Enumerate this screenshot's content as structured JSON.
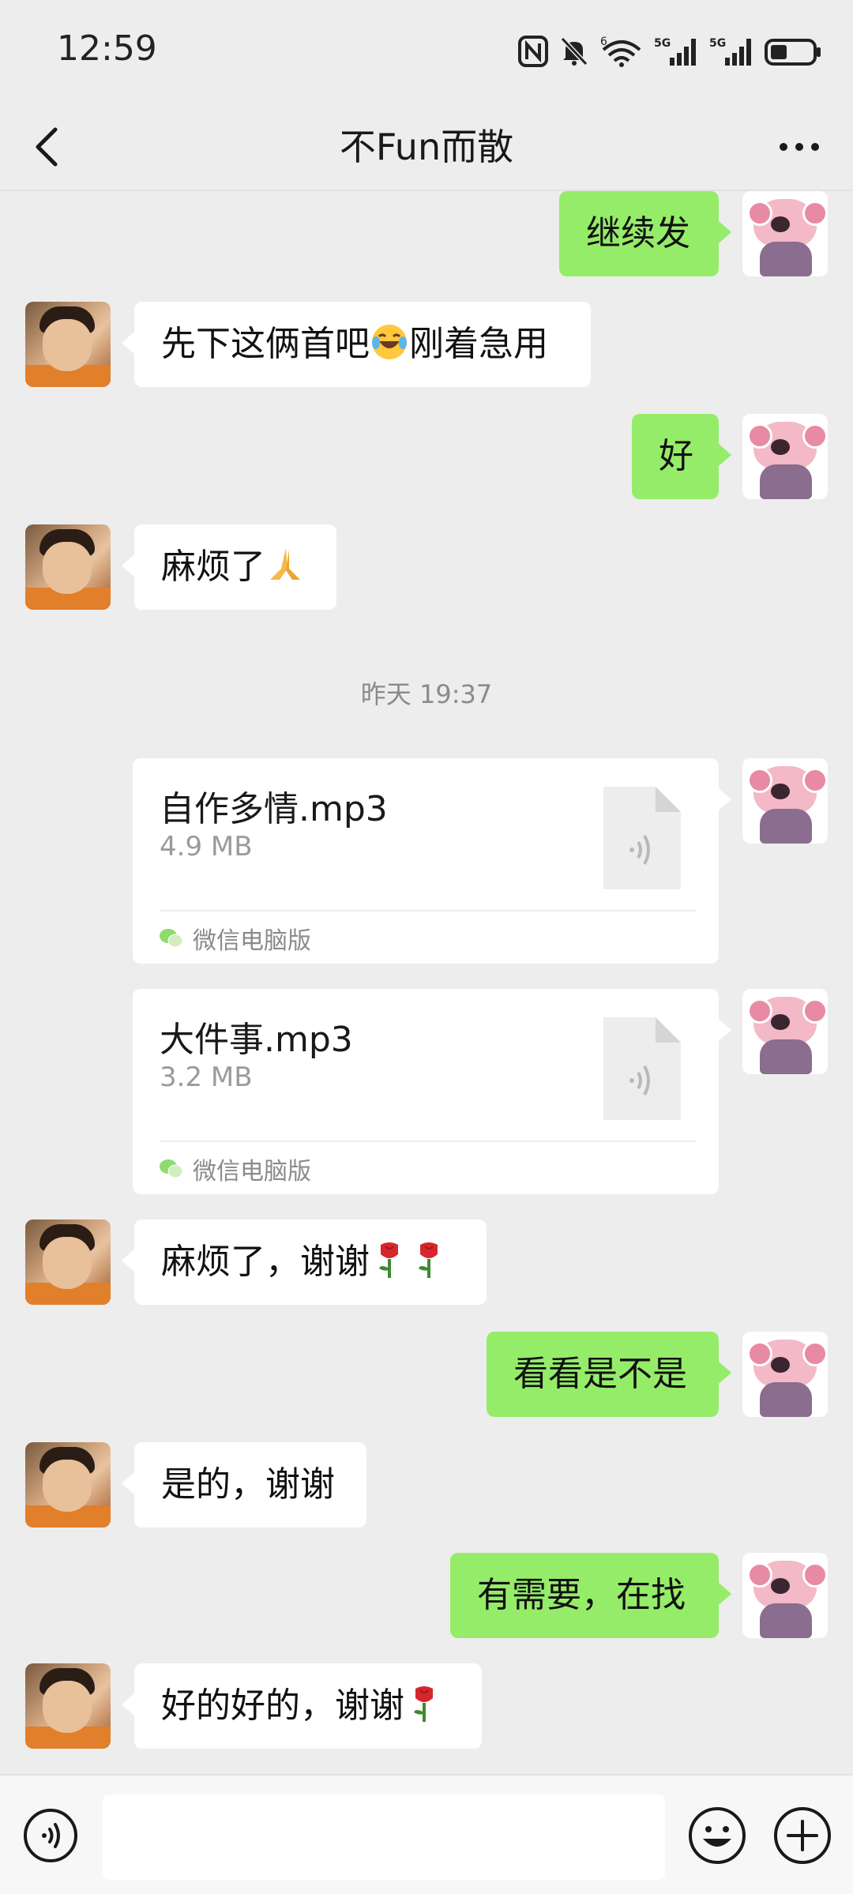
{
  "status_bar": {
    "time": "12:59",
    "icons": [
      "nfc-icon",
      "mute-icon",
      "wifi-icon",
      "signal-5g-icon",
      "signal-5g-icon",
      "battery-icon"
    ],
    "network_label_1": "5G",
    "network_label_2": "5G",
    "wifi_label": "6"
  },
  "header": {
    "title": "不Fun而散"
  },
  "messages": [
    {
      "side": "out",
      "text": "继续发"
    },
    {
      "side": "in",
      "text_before": "先下这俩首吧",
      "emoji": "laugh-cry-emoji",
      "text_after": "刚着急用"
    },
    {
      "side": "out",
      "text": "好"
    },
    {
      "side": "in",
      "text": "麻烦了",
      "emoji": "praying-hands-emoji"
    },
    {
      "type": "timestamp",
      "text": "昨天 19:37"
    },
    {
      "side": "out",
      "type": "file",
      "name": "自作多情.mp3",
      "size": "4.9 MB",
      "source": "微信电脑版"
    },
    {
      "side": "out",
      "type": "file",
      "name": "大件事.mp3",
      "size": "3.2 MB",
      "source": "微信电脑版"
    },
    {
      "side": "in",
      "text": "麻烦了，谢谢",
      "emoji_count": 2,
      "emoji": "rose-emoji"
    },
    {
      "side": "out",
      "text": "看看是不是"
    },
    {
      "side": "in",
      "text": "是的，谢谢"
    },
    {
      "side": "out",
      "text": "有需要，在找"
    },
    {
      "side": "in",
      "text": "好的好的，谢谢",
      "emoji": "rose-emoji"
    }
  ],
  "input_bar": {
    "placeholder": "",
    "value": ""
  },
  "colors": {
    "background": "#EDEDED",
    "outgoing_bubble": "#95EC69",
    "incoming_bubble": "#FFFFFF"
  }
}
